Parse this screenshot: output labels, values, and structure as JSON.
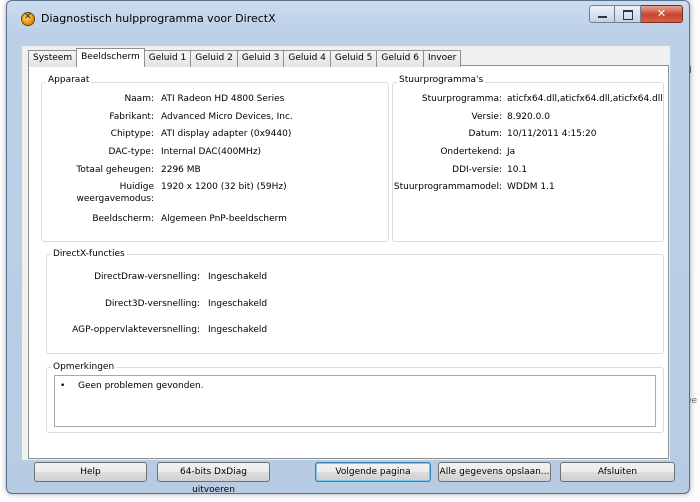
{
  "window": {
    "title": "Diagnostisch hulpprogramma voor DirectX",
    "icon": "directx-icon",
    "close_glyph": "✕"
  },
  "tabs": [
    {
      "label": "Systeem"
    },
    {
      "label": "Beeldscherm",
      "active": true
    },
    {
      "label": "Geluid 1"
    },
    {
      "label": "Geluid 2"
    },
    {
      "label": "Geluid 3"
    },
    {
      "label": "Geluid 4"
    },
    {
      "label": "Geluid 5"
    },
    {
      "label": "Geluid 6"
    },
    {
      "label": "Invoer"
    }
  ],
  "device": {
    "title": "Apparaat",
    "rows": [
      {
        "label": "Naam:",
        "value": "ATI Radeon HD 4800 Series"
      },
      {
        "label": "Fabrikant:",
        "value": "Advanced Micro Devices, Inc."
      },
      {
        "label": "Chiptype:",
        "value": "ATI display adapter (0x9440)"
      },
      {
        "label": "DAC-type:",
        "value": "Internal DAC(400MHz)"
      },
      {
        "label": "Totaal geheugen:",
        "value": "2296 MB"
      },
      {
        "label": "Huidige weergavemodus:",
        "label_line1": "Huidige",
        "label_line2": "weergavemodus:",
        "value": "1920 x 1200 (32 bit) (59Hz)"
      },
      {
        "label": "Beeldscherm:",
        "value": "Algemeen PnP-beeldscherm"
      }
    ]
  },
  "drivers": {
    "title": "Stuurprogramma's",
    "rows": [
      {
        "label": "Stuurprogramma:",
        "value": "aticfx64.dll,aticfx64.dll,aticfx64.dll"
      },
      {
        "label": "Versie:",
        "value": "8.920.0.0"
      },
      {
        "label": "Datum:",
        "value": "10/11/2011 4:15:20"
      },
      {
        "label": "Ondertekend:",
        "value": "Ja"
      },
      {
        "label": "DDI-versie:",
        "value": "10.1"
      },
      {
        "label": "Stuurprogrammamodel:",
        "value": "WDDM 1.1"
      }
    ]
  },
  "directx": {
    "title": "DirectX-functies",
    "rows": [
      {
        "label": "DirectDraw-versnelling:",
        "value": "Ingeschakeld"
      },
      {
        "label": "Direct3D-versnelling:",
        "value": "Ingeschakeld"
      },
      {
        "label": "AGP-oppervlakteversnelling:",
        "value": "Ingeschakeld"
      }
    ]
  },
  "notes": {
    "title": "Opmerkingen",
    "bullet": "•",
    "items": [
      "Geen problemen gevonden."
    ]
  },
  "buttons": {
    "help": "Help",
    "run64": "64-bits DxDiag uitvoeren",
    "next": "Volgende pagina",
    "save_all": "Alle gegevens opslaan...",
    "exit": "Afsluiten"
  },
  "background": {
    "right_letters": [
      "d",
      "ee"
    ]
  }
}
